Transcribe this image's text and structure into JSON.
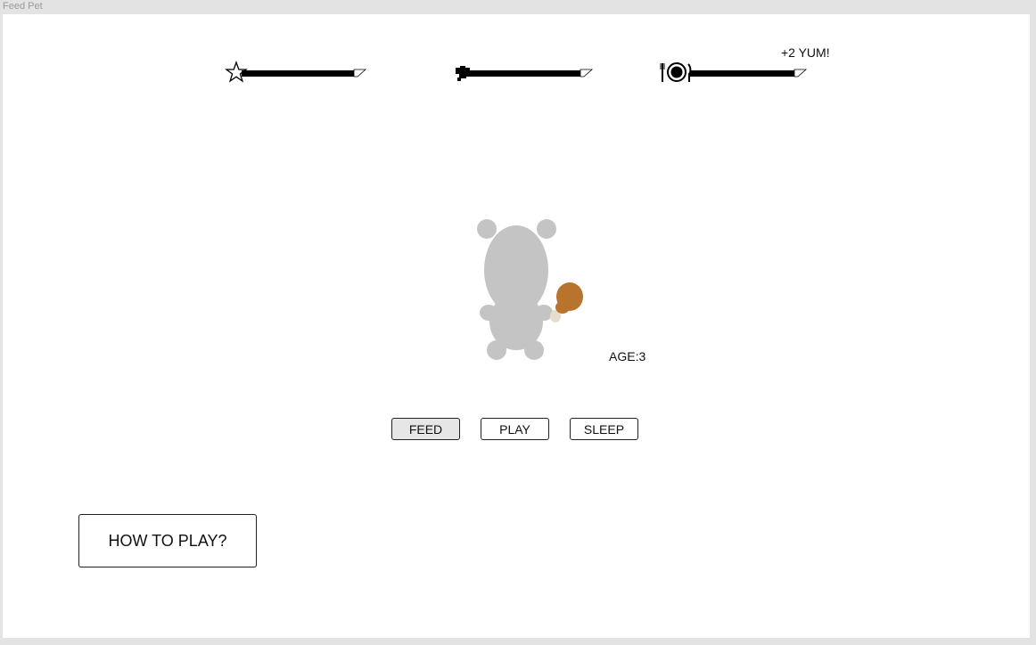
{
  "window": {
    "title": "Feed Pet"
  },
  "stats": [
    {
      "name": "happiness",
      "icon": "star-icon",
      "level": 0.93
    },
    {
      "name": "health",
      "icon": "heart-icon",
      "level": 0.94
    },
    {
      "name": "hunger",
      "icon": "plate-icon",
      "level": 0.93
    }
  ],
  "feedback": {
    "text": "+2 YUM!"
  },
  "pet": {
    "age_label": "AGE:3",
    "held_item": "drumstick-icon",
    "color": "#c4c4c4",
    "item_color": "#b8732c"
  },
  "actions": {
    "feed": "FEED",
    "play": "PLAY",
    "sleep": "SLEEP",
    "active": "feed"
  },
  "help": {
    "label": "HOW TO PLAY?"
  }
}
